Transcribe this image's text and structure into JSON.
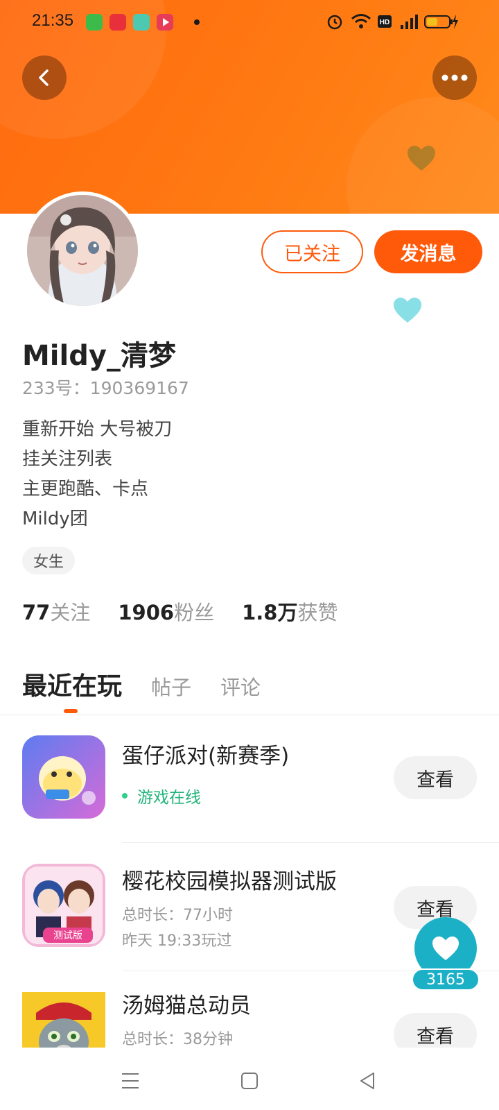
{
  "status_bar": {
    "time": "21:35",
    "icons": [
      "alarm-icon",
      "wifi-icon",
      "hd-icon",
      "5g-signal-icon",
      "battery-charging-icon"
    ],
    "notification_apps": [
      "green-app-icon",
      "red-app-icon",
      "teal-app-icon",
      "video-app-icon"
    ]
  },
  "header": {
    "back_icon": "back-arrow-icon",
    "more_icon": "more-dots-icon",
    "accent_color": "#ff6a0f"
  },
  "profile": {
    "follow_label": "已关注",
    "message_label": "发消息",
    "username": "Mildy_清梦",
    "user_id": "233号：190369167",
    "bio_lines": [
      "重新开始 大号被刀",
      "挂关注列表",
      "主更跑酷、卡点",
      "Mildy团"
    ],
    "gender_tag": "女生",
    "stats": [
      {
        "num": "77",
        "label": "关注"
      },
      {
        "num": "1906",
        "label": "粉丝"
      },
      {
        "num": "1.8万",
        "label": "获赞"
      }
    ]
  },
  "tabs": [
    {
      "label": "最近在玩",
      "active": true
    },
    {
      "label": "帖子",
      "active": false
    },
    {
      "label": "评论",
      "active": false
    }
  ],
  "games": [
    {
      "name": "蛋仔派对(新赛季)",
      "online": "游戏在线",
      "view_label": "查看"
    },
    {
      "name": "樱花校园模拟器测试版",
      "duration": "总时长：77小时",
      "last_played": "昨天 19:33玩过",
      "view_label": "查看"
    },
    {
      "name": "汤姆猫总动员",
      "duration": "总时长：38分钟",
      "view_label": "查看"
    }
  ],
  "like_fab": {
    "count": "3165",
    "icon": "heart-icon"
  },
  "nav_bar": {
    "icons": [
      "menu-icon",
      "home-square-icon",
      "back-triangle-icon"
    ]
  }
}
